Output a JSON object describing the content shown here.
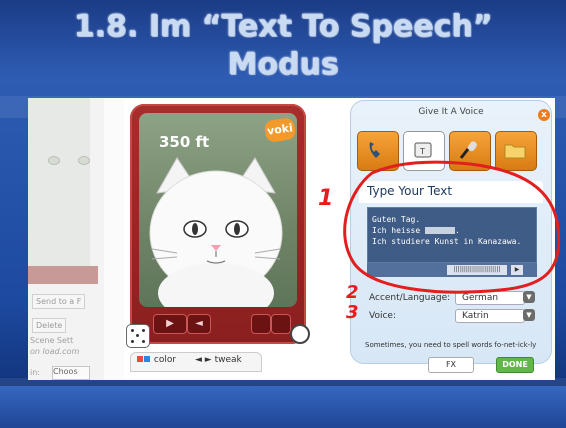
{
  "slide": {
    "title_line1": "1.8. Im “Text To Speech”",
    "title_line2": "Modus"
  },
  "left_panel": {
    "send_label": "Send to a F",
    "delete_label": "Delete",
    "scene_label": "Scene Sett",
    "load_label": "on load.com",
    "in_label": "in:",
    "choose_label": "Choos"
  },
  "phone": {
    "distance": "350 ft",
    "badge": "voki"
  },
  "bottom_tabs": {
    "color_label": "color",
    "tweak_label": "tweak"
  },
  "voice_panel": {
    "title": "Give It A Voice",
    "close": "x",
    "section_title": "Type Your Text",
    "text_lines": [
      "Guten Tag.",
      "Ich heisse",
      ".",
      "Ich studiere Kunst in Kanazawa."
    ],
    "accent_label": "Accent/Language:",
    "accent_value": "German",
    "voice_label": "Voice:",
    "voice_value": "Katrin",
    "note": "Sometimes, you need to spell words fo-net-ick-ly",
    "fx_label": "FX",
    "done_label": "DONE"
  },
  "annotations": {
    "n1": "1",
    "n2": "2",
    "n3": "3",
    "color": "#e31e1e"
  },
  "colors": {
    "slide_bg": "#1d4aa0",
    "phone_frame": "#a72e2b",
    "voice_panel": "#e9f2fb",
    "orange_button": "#f39a2a",
    "done_green": "#62b64c"
  }
}
